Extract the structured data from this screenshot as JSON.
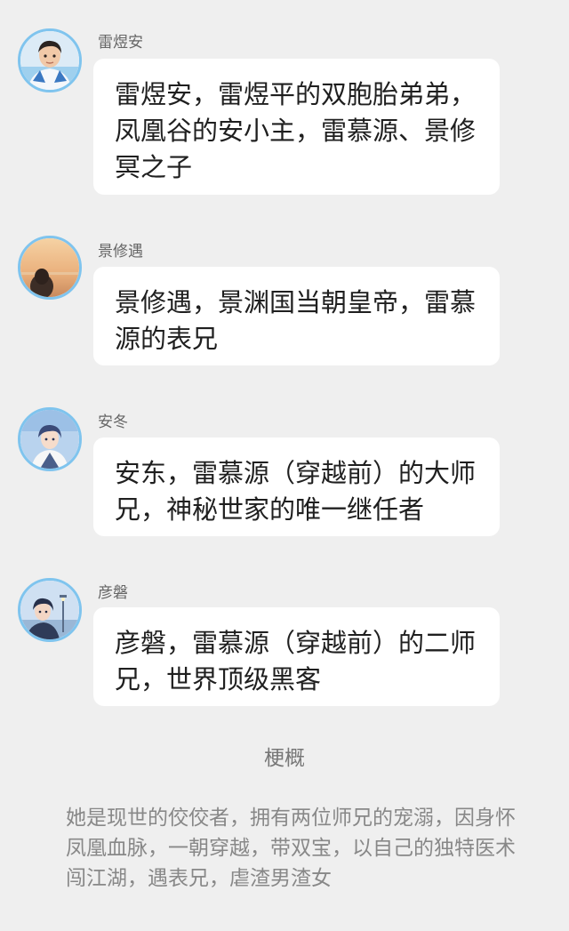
{
  "messages": [
    {
      "sender": "雷煜安",
      "text": "雷煜安，雷煜平的双胞胎弟弟，凤凰谷的安小主，雷慕源、景修冥之子",
      "avatar": "child-portrait-avatar"
    },
    {
      "sender": "景修遇",
      "text": "景修遇，景渊国当朝皇帝，雷慕源的表兄",
      "avatar": "sunset-silhouette-avatar"
    },
    {
      "sender": "安冬",
      "text": "安东，雷慕源（穿越前）的大师兄，神秘世家的唯一继任者",
      "avatar": "anime-boy-blue-avatar"
    },
    {
      "sender": "彦磐",
      "text": "彦磐，雷慕源（穿越前）的二师兄，世界顶级黑客",
      "avatar": "anime-boy-streetlamp-avatar"
    }
  ],
  "section_title": "梗概",
  "summary": "她是现世的佼佼者，拥有两位师兄的宠溺，因身怀凤凰血脉，一朝穿越，带双宝，以自己的独特医术闯江湖，遇表兄，虐渣男渣女",
  "colors": {
    "background": "#efefef",
    "bubble": "#ffffff",
    "avatar_ring": "#7fc4ee",
    "message_text": "#1f1f1f",
    "name_text": "#666666",
    "summary_text": "#888888"
  }
}
